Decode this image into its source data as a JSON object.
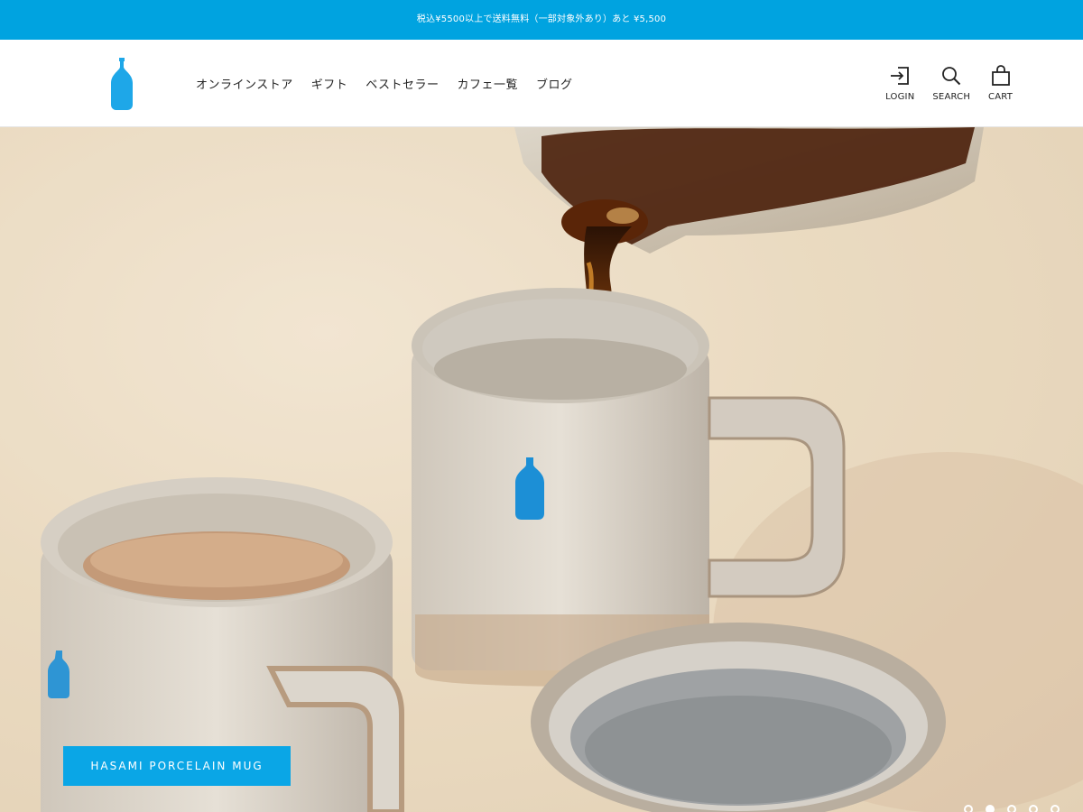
{
  "announcement": {
    "text": "税込¥5500以上で送料無料（一部対象外あり）あと ¥5,500"
  },
  "header": {
    "logo_icon": "blue-bottle-logo-icon",
    "nav": [
      {
        "label": "オンラインストア"
      },
      {
        "label": "ギフト"
      },
      {
        "label": "ベストセラー"
      },
      {
        "label": "カフェ一覧"
      },
      {
        "label": "ブログ"
      }
    ],
    "actions": {
      "login": {
        "label": "LOGIN",
        "icon": "login-icon"
      },
      "search": {
        "label": "SEARCH",
        "icon": "search-icon"
      },
      "cart": {
        "label": "CART",
        "icon": "cart-bag-icon"
      }
    }
  },
  "hero": {
    "caption": "HASAMI PORCELAIN MUG",
    "slides_total": 5,
    "active_slide": 2
  },
  "colors": {
    "brand_blue": "#00a3e0",
    "caption_blue": "#0aa6e6",
    "text": "#222222"
  }
}
